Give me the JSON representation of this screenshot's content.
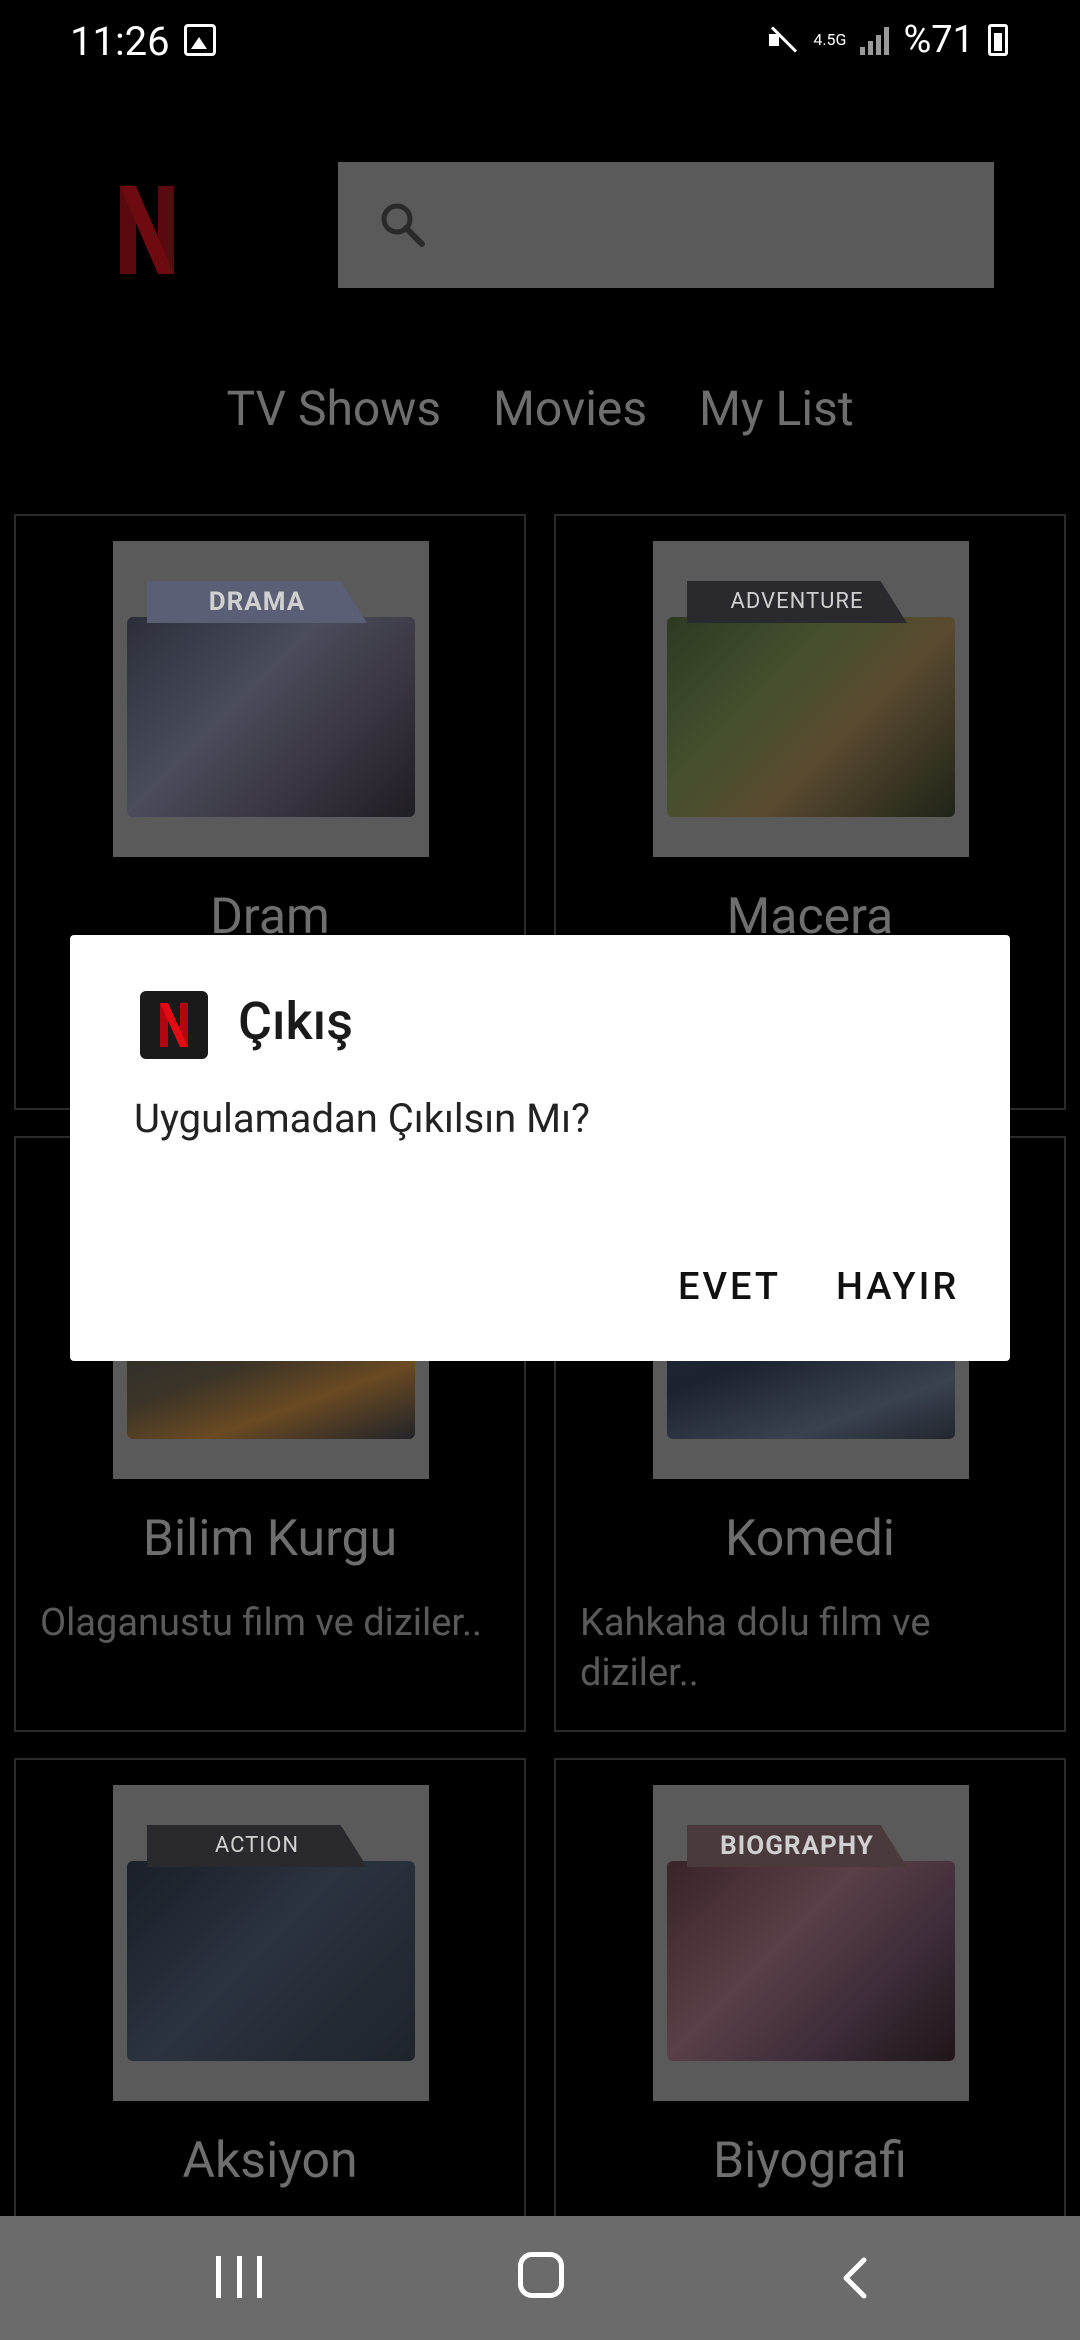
{
  "status_bar": {
    "time": "11:26",
    "network": "4.5G",
    "battery": "%71"
  },
  "header": {
    "logo": "netflix-logo",
    "search_placeholder": ""
  },
  "tabs": [
    "TV Shows",
    "Movies",
    "My List"
  ],
  "cards": [
    {
      "title": "Dram",
      "desc": "",
      "folder": "DRAMA"
    },
    {
      "title": "Macera",
      "desc": "",
      "folder": "ADVENTURE"
    },
    {
      "title": "Bilim Kurgu",
      "desc": "Olaganustu film ve diziler..",
      "folder": ""
    },
    {
      "title": "Komedi",
      "desc": "Kahkaha dolu film ve diziler..",
      "folder": ""
    },
    {
      "title": "Aksiyon",
      "desc": "",
      "folder": "ACTION"
    },
    {
      "title": "Biyografi",
      "desc": "",
      "folder": "BIOGRAPHY"
    }
  ],
  "dialog": {
    "title": "Çıkış",
    "message": "Uygulamadan Çıkılsın Mı?",
    "yes_label": "EVET",
    "no_label": "HAYIR"
  },
  "colors": {
    "accent": "#e50914",
    "dialog_bg": "#ffffff",
    "nav_bg": "#6b6b6b"
  }
}
